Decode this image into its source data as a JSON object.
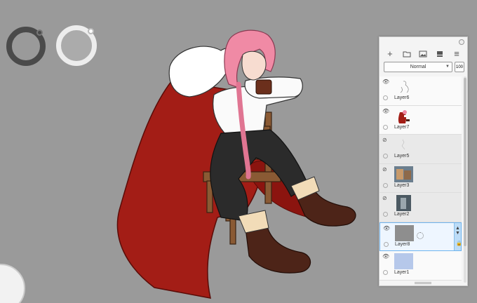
{
  "colors": {
    "canvas_bg": "#9a9a9a",
    "main_color": "#4a4a4a",
    "sub_color": "#ababab",
    "selection_accent": "#6fb4ee"
  },
  "layers_panel": {
    "blend_mode": "Normal",
    "opacity": "100",
    "toolbar_icons": [
      "add-layer-icon",
      "folder-icon",
      "image-icon",
      "layer-clip-icon",
      "menu-icon"
    ],
    "layers": [
      {
        "name": "Layer6",
        "visible": true,
        "selected": false,
        "thumb": "sketch"
      },
      {
        "name": "Layer7",
        "visible": true,
        "selected": false,
        "thumb": "character"
      },
      {
        "name": "Layer5",
        "visible": false,
        "selected": false,
        "thumb": "sketch-faint"
      },
      {
        "name": "Layer3",
        "visible": false,
        "selected": false,
        "thumb": "reference-a"
      },
      {
        "name": "Layer2",
        "visible": false,
        "selected": false,
        "thumb": "reference-b"
      },
      {
        "name": "Layer8",
        "visible": true,
        "selected": true,
        "thumb": "gray"
      },
      {
        "name": "Layer1",
        "visible": true,
        "selected": false,
        "thumb": "blue"
      }
    ]
  }
}
